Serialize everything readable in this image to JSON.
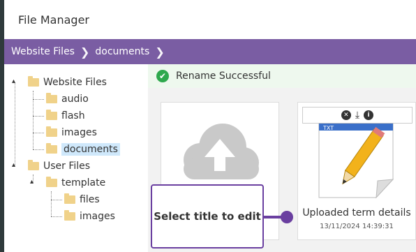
{
  "window": {
    "title": "File Manager"
  },
  "breadcrumb": [
    "Website Files",
    "documents"
  ],
  "tree": {
    "website_files": "Website Files",
    "audio": "audio",
    "flash": "flash",
    "images": "images",
    "documents": "documents",
    "user_files": "User Files",
    "template": "template",
    "files": "files",
    "template_images": "images"
  },
  "alert": {
    "text": "Rename Successful",
    "color": "#2ea84d"
  },
  "file": {
    "name": "Uploaded term details",
    "date": "13/11/2024 14:39:31",
    "type_label": "TXT"
  },
  "tooltip": {
    "text": "Select title to edit"
  },
  "colors": {
    "accent": "#7a5da3",
    "tooltip_border": "#6a3fa0",
    "folder": "#f0d28a"
  },
  "icons": [
    "folder-icon",
    "check-icon",
    "cloud-upload-icon",
    "delete-icon",
    "download-icon",
    "info-icon",
    "text-file-icon"
  ]
}
